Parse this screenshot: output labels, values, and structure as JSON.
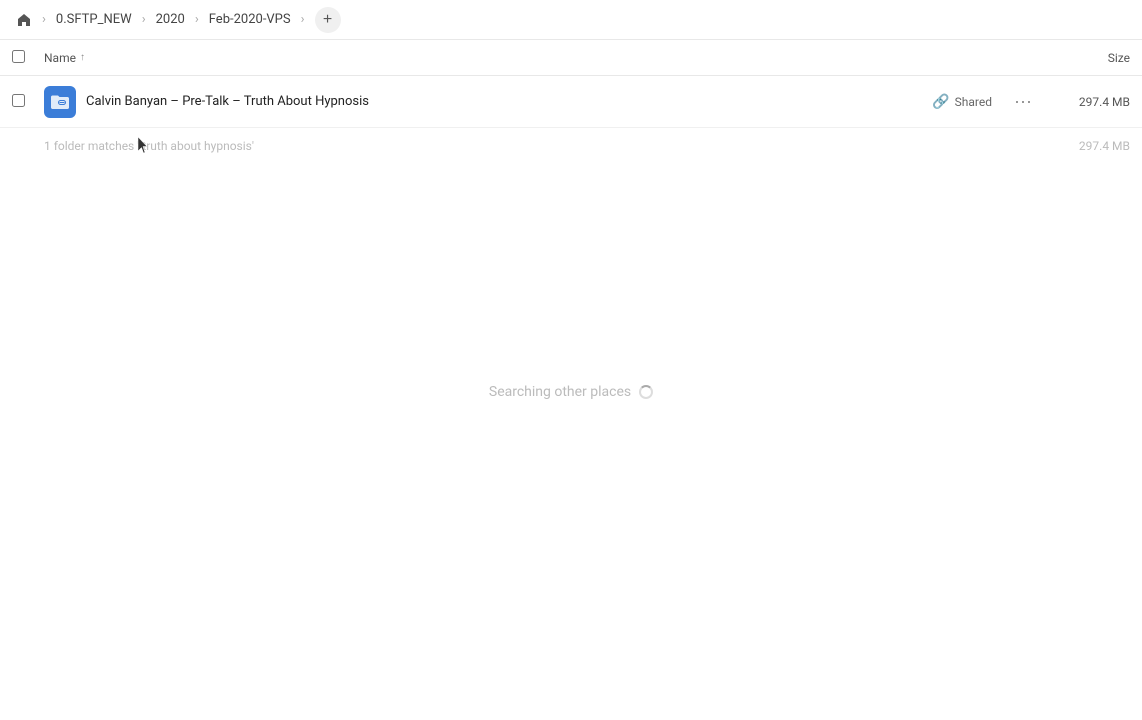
{
  "breadcrumb": {
    "home_label": "Home",
    "items": [
      {
        "label": "0.SFTP_NEW"
      },
      {
        "label": "2020"
      },
      {
        "label": "Feb-2020-VPS"
      }
    ],
    "add_button_label": "+"
  },
  "columns": {
    "name_label": "Name",
    "sort_indicator": "↑",
    "size_label": "Size"
  },
  "file_row": {
    "name": "Calvin Banyan – Pre-Talk – Truth About Hypnosis",
    "shared_label": "Shared",
    "size": "297.4 MB"
  },
  "summary": {
    "text": "1 folder matches ' truth about hypnosis'",
    "size": "297.4 MB"
  },
  "searching": {
    "text": "Searching other places"
  }
}
